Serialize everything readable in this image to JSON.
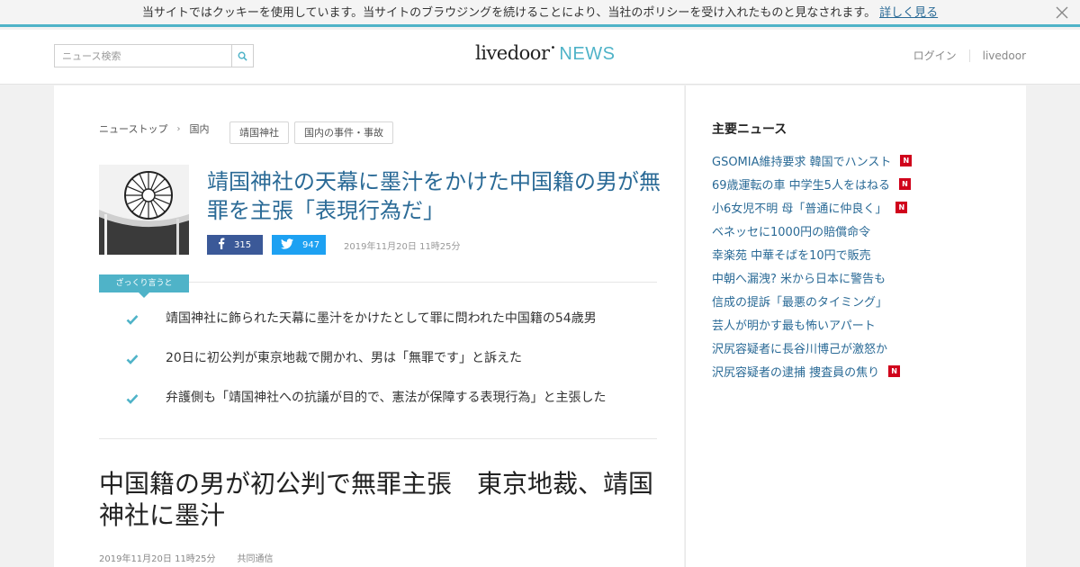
{
  "cookie_bar": {
    "text": "当サイトではクッキーを使用しています。当サイトのブラウジングを続けることにより、当社のポリシーを受け入れたものと見なされます。",
    "link": "詳しく見る"
  },
  "header": {
    "search_placeholder": "ニュース検索",
    "logo_main": "livedoor",
    "logo_dot": "•",
    "logo_news": "NEWS",
    "nav": [
      "ログイン",
      "livedoor"
    ]
  },
  "breadcrumb": {
    "items": [
      "ニューストップ",
      "国内"
    ],
    "separator": "›"
  },
  "tags": [
    "靖国神社",
    "国内の事件・事故"
  ],
  "article": {
    "headline": "靖国神社の天幕に墨汁をかけた中国籍の男が無罪を主張「表現行為だ」",
    "facebook_count": "315",
    "twitter_count": "947",
    "date": "2019年11月20日 11時25分",
    "summary_label": "ざっくり言うと",
    "summary": [
      "靖国神社に飾られた天幕に墨汁をかけたとして罪に問われた中国籍の54歳男",
      "20日に初公判が東京地裁で開かれ、男は「無罪です」と訴えた",
      "弁護側も「靖国神社への抗議が目的で、憲法が保障する表現行為」と主張した"
    ],
    "title": "中国籍の男が初公判で無罪主張　東京地裁、靖国神社に墨汁",
    "date2": "2019年11月20日 11時25分",
    "source": "共同通信"
  },
  "sidebar": {
    "title": "主要ニュース",
    "items": [
      {
        "text": "GSOMIA維持要求 韓国でハンスト",
        "new": "N"
      },
      {
        "text": "69歳運転の車 中学生5人をはねる",
        "new": "N"
      },
      {
        "text": "小6女児不明 母「普通に仲良く」",
        "new": "N"
      },
      {
        "text": "ベネッセに1000円の賠償命令",
        "new": ""
      },
      {
        "text": "幸楽苑 中華そばを10円で販売",
        "new": ""
      },
      {
        "text": "中朝へ漏洩? 米から日本に警告も",
        "new": ""
      },
      {
        "text": "信成の提訴「最悪のタイミング」",
        "new": ""
      },
      {
        "text": "芸人が明かす最も怖いアパート",
        "new": ""
      },
      {
        "text": "沢尻容疑者に長谷川博己が激怒か",
        "new": ""
      },
      {
        "text": "沢尻容疑者の逮捕 捜査員の焦り",
        "new": "N"
      }
    ]
  },
  "colors": {
    "accent": "#4fb3c8",
    "link": "#2a6a96",
    "facebook": "#3b5998",
    "twitter": "#1da1f2",
    "new_badge": "#d0021b"
  },
  "icons": {
    "search": "search-icon",
    "close": "close-icon",
    "facebook": "facebook-icon",
    "twitter": "twitter-icon",
    "check": "check-icon"
  }
}
